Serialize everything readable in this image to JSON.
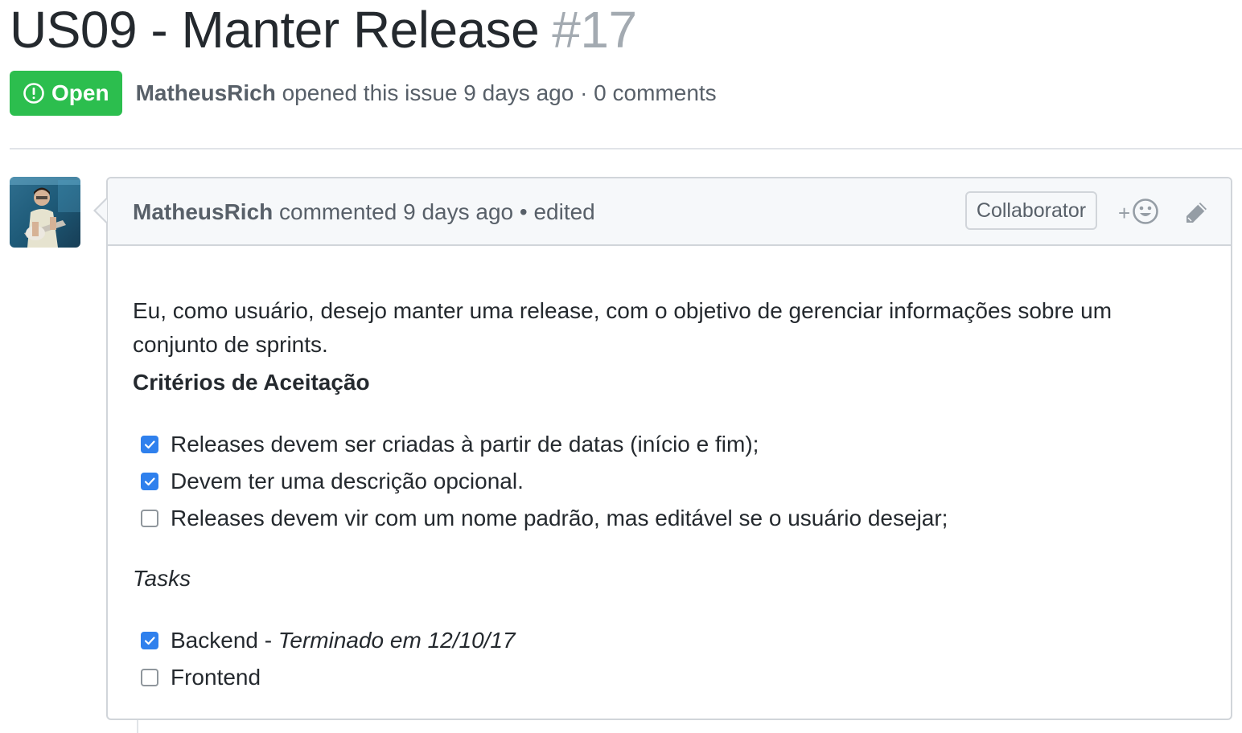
{
  "issue": {
    "title": "US09 - Manter Release",
    "number": "#17",
    "state": "Open",
    "author": "MatheusRich",
    "opened_text": "opened this issue 9 days ago · 0 comments"
  },
  "comment": {
    "author": "MatheusRich",
    "header_text": "commented 9 days ago • edited",
    "role_badge": "Collaborator",
    "reaction_label": "+",
    "body": {
      "intro": "Eu, como usuário, desejo manter uma release, com o objetivo de gerenciar informações sobre um conjunto de sprints.",
      "criteria_heading": "Critérios de Aceitação",
      "criteria": [
        {
          "text": "Releases devem ser criadas à partir de datas (início e fim);",
          "checked": true
        },
        {
          "text": "Devem ter uma descrição opcional.",
          "checked": true
        },
        {
          "text": "Releases devem vir com um nome padrão, mas editável se o usuário desejar;",
          "checked": false
        }
      ],
      "tasks_heading": "Tasks",
      "tasks": [
        {
          "text": "Backend - ",
          "note": "Terminado em 12/10/17",
          "checked": true
        },
        {
          "text": "Frontend",
          "note": "",
          "checked": false
        }
      ]
    }
  },
  "colors": {
    "open_badge": "#2cbe4e",
    "checkbox_checked": "#2f80ed",
    "muted_text": "#586069",
    "issue_number": "#a3aab1"
  },
  "icons": [
    "issue-opened-icon",
    "smiley-icon",
    "pencil-icon",
    "checkbox-checked-icon",
    "checkbox-unchecked-icon"
  ]
}
